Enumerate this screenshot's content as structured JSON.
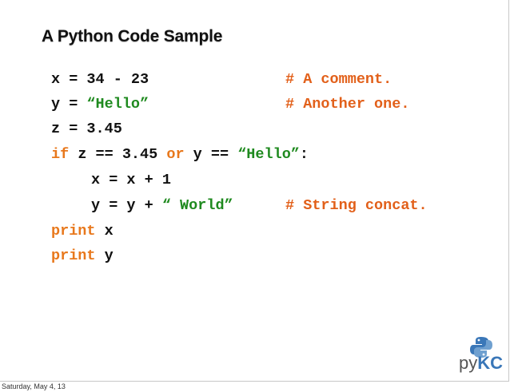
{
  "slide": {
    "title": "A Python Code Sample",
    "footer_date": "Saturday, May 4, 13",
    "logo": {
      "py": "py",
      "kc": "KC",
      "icon": "python-logo-icon"
    }
  },
  "code": {
    "line1": {
      "a": "x = 34 - 23",
      "comment": "# A comment."
    },
    "line2": {
      "a": "y = ",
      "str": "“Hello”",
      "comment": "# Another one."
    },
    "line3": {
      "a": "z = 3.45"
    },
    "line4": {
      "kw1": "if",
      "a": " z == 3.45 ",
      "kw2": "or",
      "b": " y == ",
      "str": "“Hello”",
      "c": ":"
    },
    "line5": {
      "a": "x = x + 1"
    },
    "line6": {
      "a": "y = y + ",
      "str": "“ World”",
      "comment": "# String concat."
    },
    "line7": {
      "kw": "print",
      "a": " x"
    },
    "line8": {
      "kw": "print",
      "a": " y"
    }
  },
  "colors": {
    "keyword": "#e8781c",
    "string": "#1f8a1f",
    "comment": "#e2601a",
    "text": "#111111"
  }
}
